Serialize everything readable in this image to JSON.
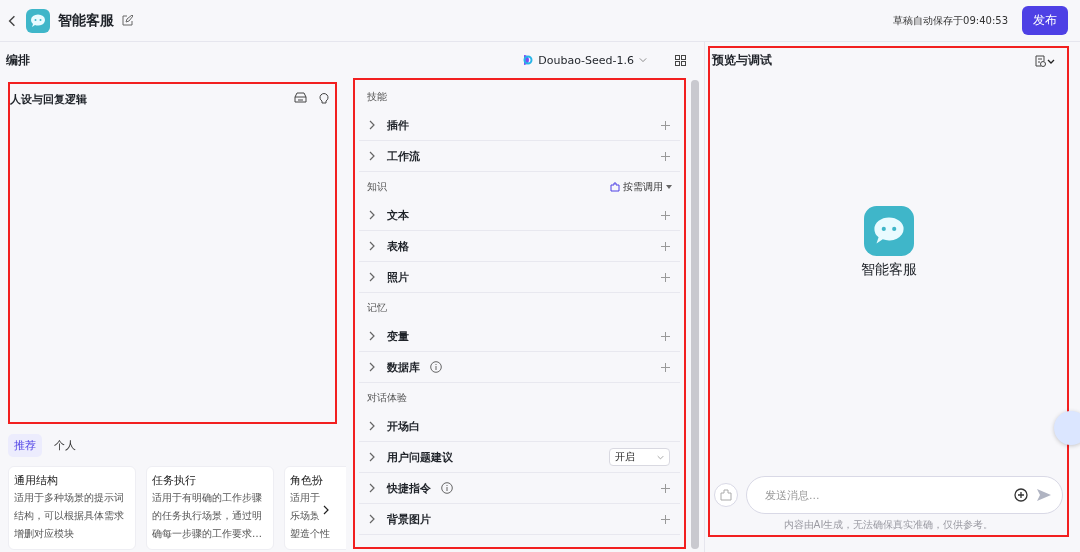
{
  "header": {
    "title": "智能客服",
    "save_status": "草稿自动保存于09:40:53",
    "publish": "发布"
  },
  "editor": {
    "title": "编排",
    "model": "Doubao-Seed-1.6"
  },
  "prompt": {
    "title": "人设与回复逻辑"
  },
  "template_tabs": [
    {
      "label": "推荐",
      "selected": true
    },
    {
      "label": "个人",
      "selected": false
    }
  ],
  "templates": [
    {
      "title": "通用结构",
      "lines": [
        "适用于多种场景的提示词",
        "结构，可以根据具体需求",
        "增删对应模块"
      ]
    },
    {
      "title": "任务执行",
      "lines": [
        "适用于有明确的工作步骤",
        "的任务执行场景，通过明",
        "确每一步骤的工作要求…"
      ]
    },
    {
      "title": "角色扮",
      "lines": [
        "适用于",
        "乐场景",
        "塑造个性"
      ]
    }
  ],
  "sections": [
    {
      "title": "技能",
      "items": [
        {
          "label": "插件",
          "info": false,
          "kind": "add"
        },
        {
          "label": "工作流",
          "info": false,
          "kind": "add"
        }
      ]
    },
    {
      "title": "知识",
      "action": "按需调用",
      "items": [
        {
          "label": "文本",
          "info": false,
          "kind": "add"
        },
        {
          "label": "表格",
          "info": false,
          "kind": "add"
        },
        {
          "label": "照片",
          "info": false,
          "kind": "add"
        }
      ]
    },
    {
      "title": "记忆",
      "items": [
        {
          "label": "变量",
          "info": false,
          "kind": "add"
        },
        {
          "label": "数据库",
          "info": true,
          "kind": "add"
        }
      ]
    },
    {
      "title": "对话体验",
      "items": [
        {
          "label": "开场白",
          "info": false,
          "kind": "none"
        },
        {
          "label": "用户问题建议",
          "info": false,
          "kind": "select",
          "value": "开启"
        },
        {
          "label": "快捷指令",
          "info": true,
          "kind": "add"
        },
        {
          "label": "背景图片",
          "info": false,
          "kind": "add"
        }
      ]
    }
  ],
  "preview": {
    "title": "预览与调试",
    "bot_name": "智能客服",
    "input": {
      "placeholder": "发送消息..."
    },
    "note": "内容由AI生成，无法确保真实准确，仅供参考。"
  }
}
